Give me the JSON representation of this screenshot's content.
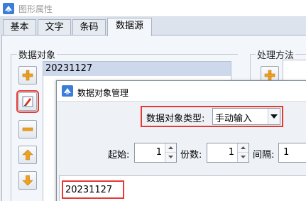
{
  "window": {
    "title": "图形属性",
    "icon": "app-properties-icon"
  },
  "tabs": [
    {
      "label": "基本",
      "active": false
    },
    {
      "label": "文字",
      "active": false
    },
    {
      "label": "条码",
      "active": false
    },
    {
      "label": "数据源",
      "active": true
    }
  ],
  "data_objects": {
    "label": "数据对象",
    "items": [
      "20231127"
    ],
    "buttons": [
      "add-icon",
      "edit-icon",
      "remove-icon",
      "move-up-icon",
      "move-down-icon"
    ]
  },
  "processing": {
    "label": "处理方法",
    "buttons": [
      "add-icon"
    ]
  },
  "dialog": {
    "title": "数据对象管理",
    "icon": "dialog-app-icon",
    "type_label": "数据对象类型:",
    "type_value": "手动输入",
    "start_label": "起始:",
    "start_value": "1",
    "count_label": "份数:",
    "count_value": "1",
    "interval_label": "间隔:",
    "interval_value": "1",
    "content_value": "20231127"
  },
  "colors": {
    "highlight": "#e53935",
    "selection": "#cdd8ec",
    "accent_icon": "#f0a020"
  }
}
